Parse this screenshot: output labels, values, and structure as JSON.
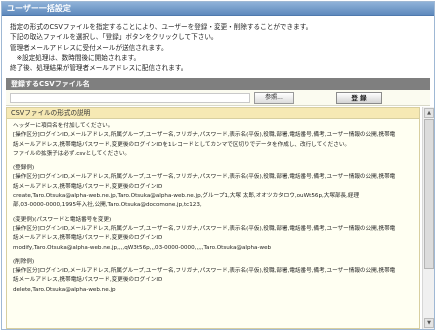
{
  "window": {
    "title": "ユーザー一括設定"
  },
  "intro": {
    "lines": [
      "指定の形式のCSVファイルを指定することにより、ユーザーを登録・変更・削除することができます。",
      "下記の取込ファイルを選択し、「登録」ボタンをクリックして下さい。",
      "管理者メールアドレスに受付メールが送信されます。",
      "　※設定処理は、数時間後に開始されます。",
      "終了後、処理結果が管理者メールアドレスに配信されます。"
    ]
  },
  "upload": {
    "header": "登録するCSVファイル名",
    "file_value": "",
    "browse_label": "参照...",
    "register_label": "登 録"
  },
  "spec": {
    "header": "CSVファイルの形式の説明",
    "lines": [
      "ヘッダーに項目名を付加してください。",
      "[操作区分]ログインID,メールアドレス,所属グループ,ユーザー名,フリガナ,パスワード,表示名(平仮),役職,部署,電話番号,備考,ユーザー情報の公開,携帯電",
      "話メールアドレス,携帯電話パスワード,変更後のログインIDを1レコードとしてカンマで区切りでデータを作成し、改行してください。",
      "ファイルの拡張子は必ず.csvとしてください。",
      "",
      "(登録例)",
      "[操作区分]ログインID,メールアドレス,所属グループ,ユーザー名,フリガナ,パスワード,表示名(平仮),役職,部署,電話番号,備考,ユーザー情報の公開,携帯電",
      "話メールアドレス,携帯電話パスワード,変更後のログインID",
      "create,Taro.Otsuka@alpha-web.ne.jp,Taro.Otsuka@alpha-web.ne.jp,グループ1,大塚 太郎,オオツカタロウ,ouWt56p,大塚部長,経理",
      "部,03-0000-0000,1995年入社,公開,Taro.Otsuka@docomone.jp,tc123,",
      "",
      "(変更例)(パスワードと電話番号を変更)",
      "[操作区分]ログインID,メールアドレス,所属グループ,ユーザー名,フリガナ,パスワード,表示名(平仮),役職,部署,電話番号,備考,ユーザー情報の公開,携帯電",
      "話メールアドレス,携帯電話パスワード,変更後のログインID",
      "modify,Taro.Otsuka@alpha-web.ne.jp,,,,qW3t56p,,,03-0000-0000,,,,,Taro.Otsuka@alpha-web",
      "",
      "(削除例)",
      "[操作区分]ログインID,メールアドレス,所属グループ,ユーザー名,フリガナ,パスワード,表示名(平仮),役職,部署,電話番号,備考,ユーザー情報の公開,携帯電",
      "話メールアドレス,携帯電話パスワード,変更後のログインID",
      "delete,Taro.Otsuka@alpha-web.ne.jp"
    ]
  }
}
